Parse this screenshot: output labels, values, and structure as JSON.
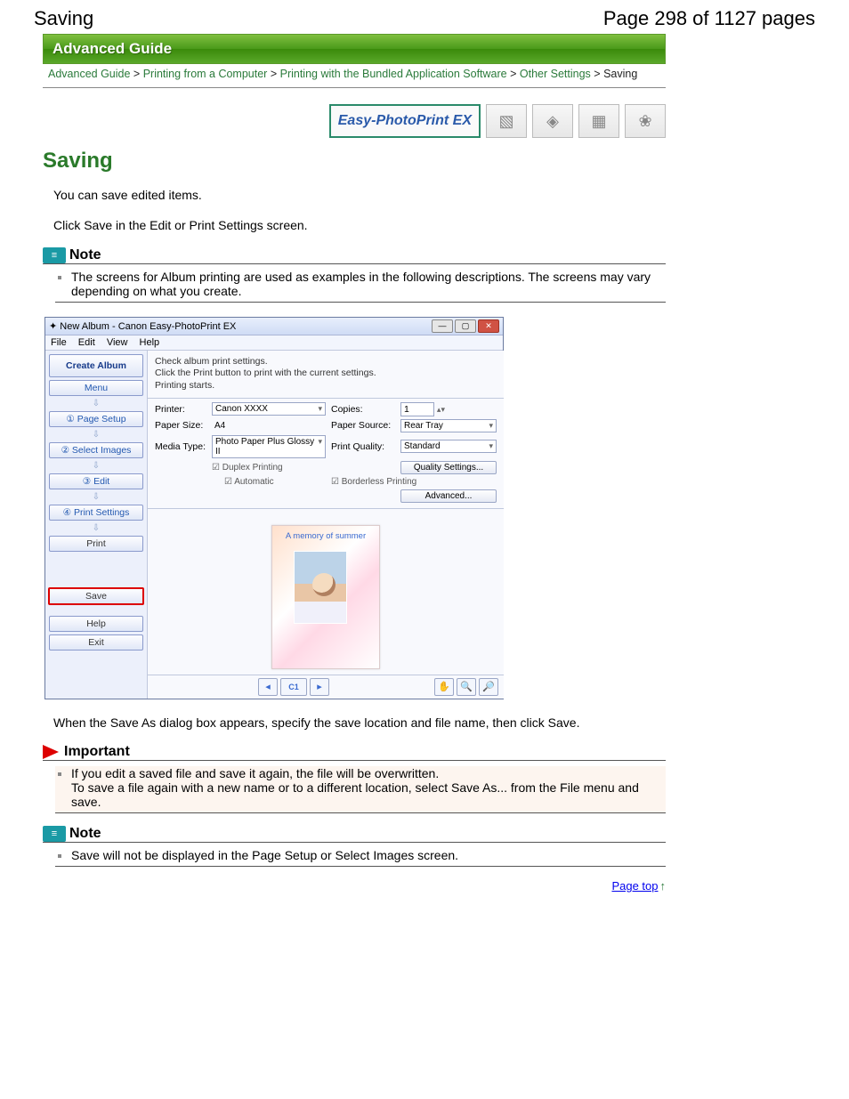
{
  "header": {
    "title_left": "Saving",
    "title_right": "Page 298 of 1127 pages"
  },
  "guide_header": "Advanced Guide",
  "breadcrumb": {
    "items": [
      "Advanced Guide",
      "Printing from a Computer",
      "Printing with the Bundled Application Software",
      "Other Settings"
    ],
    "current": "Saving",
    "sep": " > "
  },
  "logo_label": "Easy-PhotoPrint EX",
  "page_title": "Saving",
  "intro_1": "You can save edited items.",
  "intro_2": "Click Save in the Edit or Print Settings screen.",
  "note_label": "Note",
  "note1_text": "The screens for Album printing are used as examples in the following descriptions. The screens may vary depending on what you create.",
  "after_shot_text": "When the Save As dialog box appears, specify the save location and file name, then click Save.",
  "important_label": "Important",
  "important_text": "If you edit a saved file and save it again, the file will be overwritten.\nTo save a file again with a new name or to a different location, select Save As... from the File menu and save.",
  "note2_text": "Save will not be displayed in the Page Setup or Select Images screen.",
  "page_top": "Page top",
  "app": {
    "title": "New Album - Canon Easy-PhotoPrint EX",
    "menus": [
      "File",
      "Edit",
      "View",
      "Help"
    ],
    "side_title": "Create Album",
    "side_menu": "Menu",
    "side_steps": [
      "①   Page Setup",
      "②  Select Images",
      "③      Edit",
      "④   Print Settings"
    ],
    "side_print": "Print",
    "side_save": "Save",
    "side_help": "Help",
    "side_exit": "Exit",
    "instr": "Check album print settings.\nClick the Print button to print with the current settings.\nPrinting starts.",
    "labels": {
      "printer": "Printer:",
      "paper_size": "Paper Size:",
      "media_type": "Media Type:",
      "copies": "Copies:",
      "paper_source": "Paper Source:",
      "print_quality": "Print Quality:",
      "duplex": "Duplex Printing",
      "automatic": "Automatic",
      "borderless": "Borderless Printing",
      "quality_btn": "Quality Settings...",
      "advanced_btn": "Advanced..."
    },
    "values": {
      "printer": "Canon XXXX",
      "paper_size": "A4",
      "media_type": "Photo Paper Plus Glossy II",
      "copies": "1",
      "paper_source": "Rear Tray",
      "print_quality": "Standard"
    },
    "preview_caption": "A memory of summer",
    "nav_page": "C1"
  }
}
